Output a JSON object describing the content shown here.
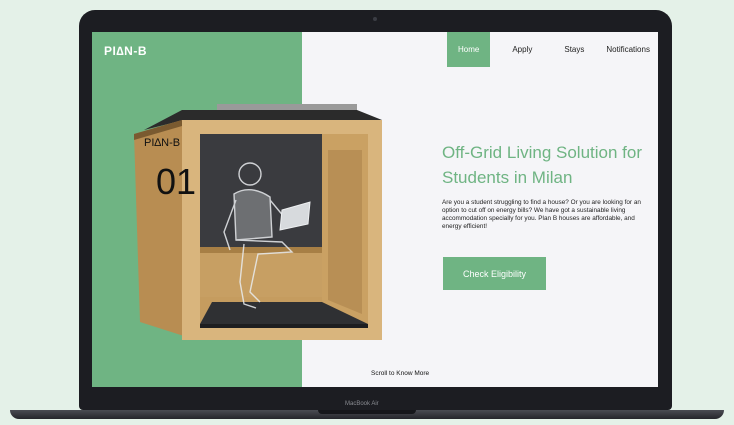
{
  "brand": {
    "logo": "PI∆N-B"
  },
  "nav": {
    "items": [
      {
        "label": "Home",
        "active": true
      },
      {
        "label": "Apply",
        "active": false
      },
      {
        "label": "Stays",
        "active": false
      },
      {
        "label": "Notifications",
        "active": false
      }
    ]
  },
  "hero": {
    "title": "Off-Grid Living Solution for Students in Milan",
    "description": "Are you a student struggling to find a house? Or you are looking for an option to cut off on energy bills? We have got a sustainable living accommodation specially for you. Plan B houses are affordable, and energy efficient!",
    "cta_label": "Check Eligibility",
    "scroll_hint": "Scroll to Know More"
  },
  "pod": {
    "brand_text": "PI∆N-B",
    "number": "01"
  },
  "device": {
    "model": "MacBook Air"
  },
  "colors": {
    "accent": "#6fb483",
    "background": "#e4f1e8",
    "screen_bg": "#f5f5f8"
  }
}
